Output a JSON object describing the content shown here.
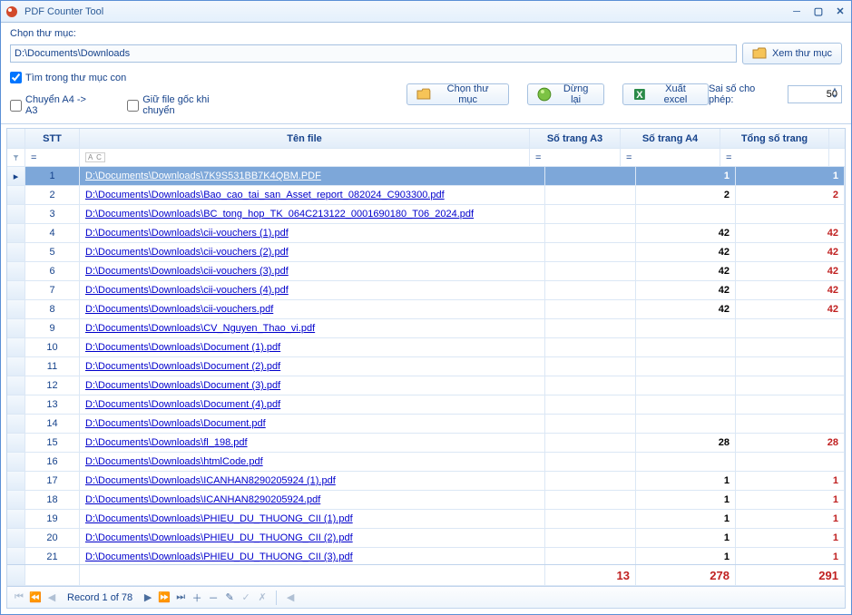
{
  "window": {
    "title": "PDF Counter Tool"
  },
  "labels": {
    "choose_dir": "Chọn thư mục:",
    "path_value": "D:\\Documents\\Downloads",
    "view_dir_btn": "Xem thư mục",
    "search_sub": "Tìm trong thư mục con",
    "convert_a4a3": "Chuyển A4 -> A3",
    "keep_orig": "Giữ file gốc khi chuyển",
    "choose_dir_btn": "Chọn thư mục",
    "stop_btn": "Dừng lại",
    "export_btn": "Xuất excel",
    "err_allow": "Sai số cho phép:",
    "err_value": "50"
  },
  "grid": {
    "headers": {
      "stt": "STT",
      "file": "Tên file",
      "a3": "Số trang A3",
      "a4": "Số trang A4",
      "total": "Tổng số trang"
    },
    "filter_eq": "=",
    "filter_abc": "A C",
    "rows": [
      {
        "stt": 1,
        "file": "D:\\Documents\\Downloads\\7K9S531BB7K4QBM.PDF",
        "a3": "",
        "a4": "1",
        "tot": "1",
        "sel": true
      },
      {
        "stt": 2,
        "file": "D:\\Documents\\Downloads\\Bao_cao_tai_san_Asset_report_082024_C903300.pdf",
        "a3": "",
        "a4": "2",
        "tot": "2"
      },
      {
        "stt": 3,
        "file": "D:\\Documents\\Downloads\\BC_tong_hop_TK_064C213122_0001690180_T06_2024.pdf",
        "a3": "",
        "a4": "",
        "tot": ""
      },
      {
        "stt": 4,
        "file": "D:\\Documents\\Downloads\\cii-vouchers (1).pdf",
        "a3": "",
        "a4": "42",
        "tot": "42"
      },
      {
        "stt": 5,
        "file": "D:\\Documents\\Downloads\\cii-vouchers (2).pdf",
        "a3": "",
        "a4": "42",
        "tot": "42"
      },
      {
        "stt": 6,
        "file": "D:\\Documents\\Downloads\\cii-vouchers (3).pdf",
        "a3": "",
        "a4": "42",
        "tot": "42"
      },
      {
        "stt": 7,
        "file": "D:\\Documents\\Downloads\\cii-vouchers (4).pdf",
        "a3": "",
        "a4": "42",
        "tot": "42"
      },
      {
        "stt": 8,
        "file": "D:\\Documents\\Downloads\\cii-vouchers.pdf",
        "a3": "",
        "a4": "42",
        "tot": "42"
      },
      {
        "stt": 9,
        "file": "D:\\Documents\\Downloads\\CV_Nguyen_Thao_vi.pdf",
        "a3": "",
        "a4": "",
        "tot": ""
      },
      {
        "stt": 10,
        "file": "D:\\Documents\\Downloads\\Document (1).pdf",
        "a3": "",
        "a4": "",
        "tot": ""
      },
      {
        "stt": 11,
        "file": "D:\\Documents\\Downloads\\Document (2).pdf",
        "a3": "",
        "a4": "",
        "tot": ""
      },
      {
        "stt": 12,
        "file": "D:\\Documents\\Downloads\\Document (3).pdf",
        "a3": "",
        "a4": "",
        "tot": ""
      },
      {
        "stt": 13,
        "file": "D:\\Documents\\Downloads\\Document (4).pdf",
        "a3": "",
        "a4": "",
        "tot": ""
      },
      {
        "stt": 14,
        "file": "D:\\Documents\\Downloads\\Document.pdf",
        "a3": "",
        "a4": "",
        "tot": ""
      },
      {
        "stt": 15,
        "file": "D:\\Documents\\Downloads\\fl_198.pdf",
        "a3": "",
        "a4": "28",
        "tot": "28"
      },
      {
        "stt": 16,
        "file": "D:\\Documents\\Downloads\\htmlCode.pdf",
        "a3": "",
        "a4": "",
        "tot": ""
      },
      {
        "stt": 17,
        "file": "D:\\Documents\\Downloads\\ICANHAN8290205924 (1).pdf",
        "a3": "",
        "a4": "1",
        "tot": "1"
      },
      {
        "stt": 18,
        "file": "D:\\Documents\\Downloads\\ICANHAN8290205924.pdf",
        "a3": "",
        "a4": "1",
        "tot": "1"
      },
      {
        "stt": 19,
        "file": "D:\\Documents\\Downloads\\PHIEU_DU_THUONG_CII (1).pdf",
        "a3": "",
        "a4": "1",
        "tot": "1"
      },
      {
        "stt": 20,
        "file": "D:\\Documents\\Downloads\\PHIEU_DU_THUONG_CII (2).pdf",
        "a3": "",
        "a4": "1",
        "tot": "1"
      },
      {
        "stt": 21,
        "file": "D:\\Documents\\Downloads\\PHIEU_DU_THUONG_CII (3).pdf",
        "a3": "",
        "a4": "1",
        "tot": "1"
      }
    ],
    "totals": {
      "a3": "13",
      "a4": "278",
      "tot": "291"
    }
  },
  "nav": {
    "text": "Record 1 of 78"
  }
}
